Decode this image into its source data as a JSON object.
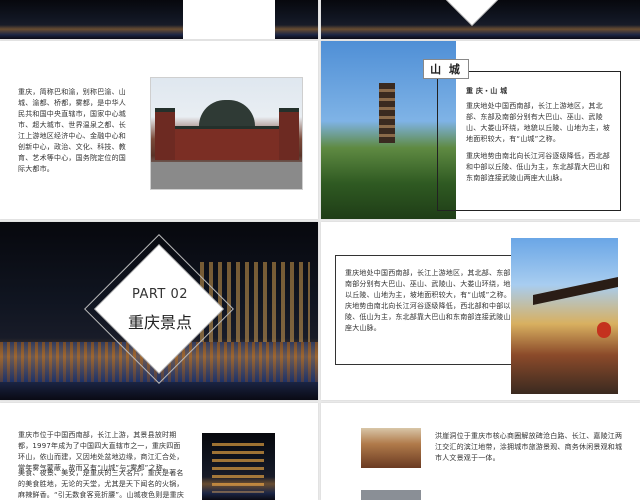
{
  "slides": {
    "s1": {
      "intro": "重庆，简称巴和渝，别称巴渝、山城、渝都、桥都，雾都，是中华人民共和国中央直辖市，国家中心城市、超大城市、世界温泉之都、长江上游地区经济中心、金融中心和创新中心，政治、文化、科技、教育、艺术等中心，国务院定位的国际大都市。"
    },
    "s2": {
      "tag": "山 城",
      "heading": "重 庆・山 城",
      "para1": "重庆地处中国西南部，长江上游地区，其北部、东部及南部分别有大巴山、巫山、武陵山、大娄山环绕，地貌以丘陵、山地为主，坡地面积较大，有“山城”之称。",
      "para2": "重庆地势由南北向长江河谷逐级降低，西北部和中部以丘陵、低山为主，东北部靠大巴山和东南部连接武陵山两座大山脉。"
    },
    "s3": {
      "part": "PART 02",
      "title": "重庆景点"
    },
    "s4": {
      "body": "重庆地处中国西南部，长江上游地区，其北部、东部及南部分别有大巴山、巫山、武陵山、大娄山环绕，地貌以丘陵、山地为主，坡地面积较大，有“山城”之称。重庆地势由南北向长江河谷逐级降低，西北部和中部以丘陵、低山为主，东北部靠大巴山和东南部连接武陵山两座大山脉。"
    },
    "s5": {
      "para1": "重庆市位于中国西南部，长江上游，其景县放时期都，1997年成为了中国四大直辖市之一，重庆四面环山，依山而建，又因地处盆地边缘，商江汇合处，常年雾气蒙蔽，故而又有“山城”与“雾都”之称。",
      "para2": "美食、夜景、美女，是重庆的三大名片，重庆是著名的美食胜地，无论的天堂，尤其是天下闻名的火锅，麻辣鲜香。“引无数食客竞折腰”。山城夜色则是重庆最为著名的一景，不论是立于南山上，还是坐长江索道从空中俯瞰，都"
    },
    "s6": {
      "body": "洪崖洞位于重庆市核心商圈解放碑沧白路、长江、嘉陵江两江交汇的滨江地带，涂拥城市旅游景观、商务休闲景观和城市人文景观于一体。"
    }
  },
  "colors": {
    "accent": "#222222",
    "page_bg": "#e9e9e9",
    "slide_bg": "#ffffff"
  }
}
